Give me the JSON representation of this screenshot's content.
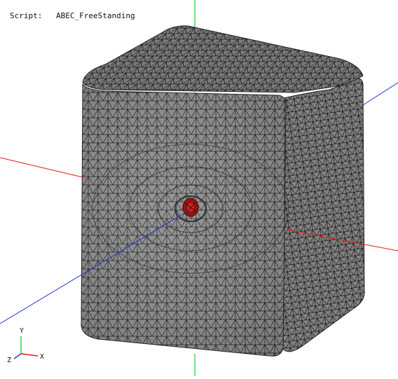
{
  "script": {
    "label": "Script:",
    "name": "ABEC_FreeStanding"
  },
  "axis_triad": {
    "x_label": "X",
    "y_label": "Y",
    "z_label": "Z"
  },
  "colors": {
    "background": "#ffffff",
    "mesh_fill": "#8c8c8c",
    "mesh_lines": "#1a1a1a",
    "x_axis": "#e41a1c",
    "y_axis": "#22cc44",
    "z_axis": "#2233dd",
    "driver": "#b01818"
  }
}
